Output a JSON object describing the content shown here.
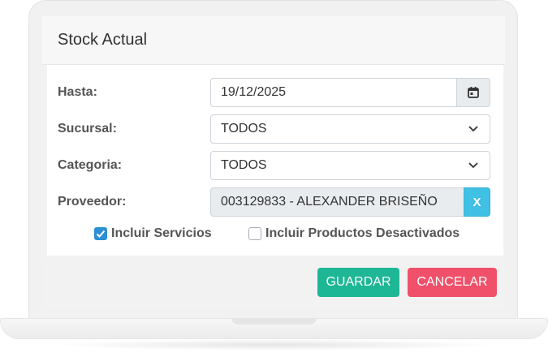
{
  "dialog": {
    "title": "Stock Actual"
  },
  "form": {
    "hasta": {
      "label": "Hasta:",
      "value": "19/12/2025"
    },
    "sucursal": {
      "label": "Sucursal:",
      "value": "TODOS"
    },
    "categoria": {
      "label": "Categoria:",
      "value": "TODOS"
    },
    "proveedor": {
      "label": "Proveedor:",
      "value": "003129833 - ALEXANDER BRISEÑO",
      "clear_label": "X"
    },
    "incluir_servicios": {
      "label": "Incluir Servicios",
      "checked": true
    },
    "incluir_desactivados": {
      "label": "Incluir Productos Desactivados",
      "checked": false
    }
  },
  "actions": {
    "save_label": "GUARDAR",
    "cancel_label": "CANCELAR"
  },
  "colors": {
    "save": "#1db795",
    "cancel": "#f0506a",
    "clear": "#3fc0e4",
    "checkbox": "#2d8fd5"
  },
  "icons": {
    "date": "calendar-icon",
    "select": "chevron-down-icon",
    "check": "checkmark-icon"
  }
}
